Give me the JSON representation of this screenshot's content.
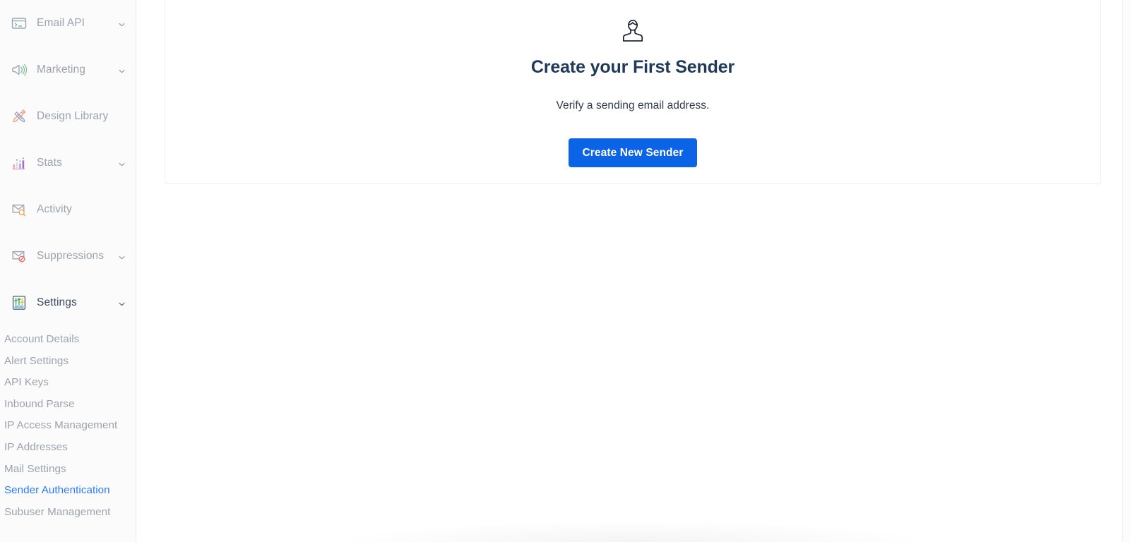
{
  "colors": {
    "accent_blue": "#0b63e5",
    "link_blue": "#2a7cf7",
    "heading_navy": "#1f3a5b",
    "muted_text": "#9ba3ad",
    "active_nav_text": "#3d4b60",
    "sidebar_bg": "#fbfbfc",
    "card_border": "#eceef1"
  },
  "sidebar": {
    "items": [
      {
        "label": "Email API",
        "icon": "terminal-icon",
        "expandable": true,
        "active": false
      },
      {
        "label": "Marketing",
        "icon": "megaphone-icon",
        "expandable": true,
        "active": false
      },
      {
        "label": "Design Library",
        "icon": "pencil-ruler-icon",
        "expandable": false,
        "active": false
      },
      {
        "label": "Stats",
        "icon": "bar-chart-icon",
        "expandable": true,
        "active": false
      },
      {
        "label": "Activity",
        "icon": "envelope-search-icon",
        "expandable": false,
        "active": false
      },
      {
        "label": "Suppressions",
        "icon": "envelope-block-icon",
        "expandable": true,
        "active": false
      },
      {
        "label": "Settings",
        "icon": "sliders-icon",
        "expandable": true,
        "active": true
      }
    ],
    "settings_submenu": [
      {
        "label": "Account Details",
        "current": false
      },
      {
        "label": "Alert Settings",
        "current": false
      },
      {
        "label": "API Keys",
        "current": false
      },
      {
        "label": "Inbound Parse",
        "current": false
      },
      {
        "label": "IP Access Management",
        "current": false
      },
      {
        "label": "IP Addresses",
        "current": false
      },
      {
        "label": "Mail Settings",
        "current": false
      },
      {
        "label": "Sender Authentication",
        "current": true
      },
      {
        "label": "Subuser Management",
        "current": false
      }
    ]
  },
  "main": {
    "empty_state": {
      "icon": "person-avatar-icon",
      "title": "Create your First Sender",
      "subtitle": "Verify a sending email address.",
      "cta_label": "Create New Sender"
    }
  }
}
